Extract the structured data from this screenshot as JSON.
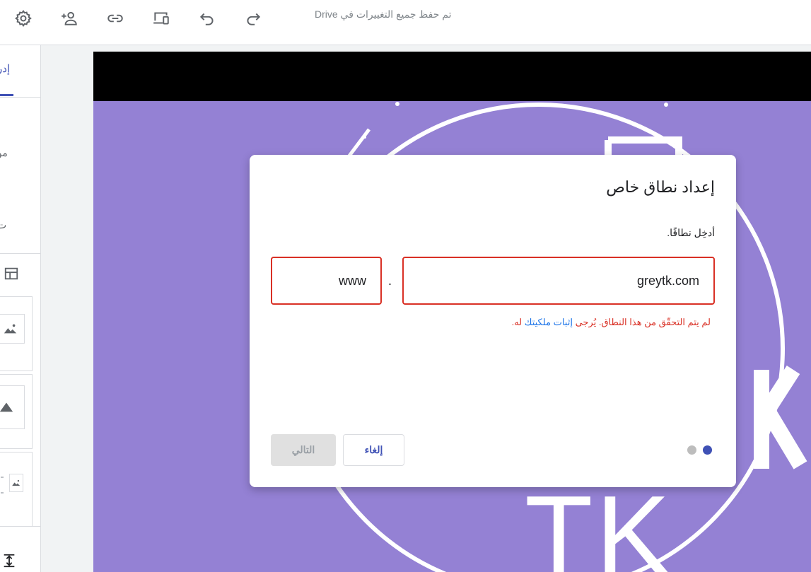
{
  "toolbar": {
    "save_status": "تم حفظ جميع التغييرات في Drive",
    "icons": [
      "gear-icon",
      "add-person-icon",
      "link-icon",
      "devices-icon",
      "undo-icon",
      "redo-icon"
    ]
  },
  "sidebar": {
    "tab_label": "إدر",
    "text_1": "مو",
    "text_2": "ت"
  },
  "dialog": {
    "title": "إعداد نطاق خاص",
    "domain_label": "أدخِل نطاقًا.",
    "domain_value": "greytk.com",
    "subdomain_value": "www",
    "separator": ".",
    "error_text": "لم يتم التحقّق من هذا النطاق. يُرجى ",
    "error_link": "إثبات ملكيتك",
    "error_suffix": " له.",
    "cancel_label": "إلغاء",
    "next_label": "التالي",
    "steps": {
      "current": 1,
      "total": 2
    }
  },
  "banner": {
    "logo_text": "TK"
  },
  "colors": {
    "accent": "#3f51b5",
    "error": "#d93025",
    "banner_bg": "#9481d4",
    "link": "#1a73e8"
  }
}
